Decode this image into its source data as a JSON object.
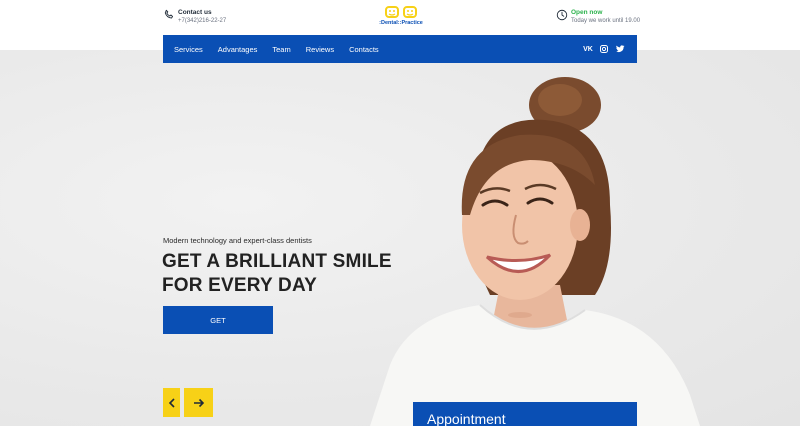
{
  "header": {
    "contact_title": "Contact us",
    "contact_phone": "+7(342)216-22-27",
    "logo_text": ":Dental::Practice",
    "hours_title": "Open now",
    "hours_sub": "Today we work until 19.00"
  },
  "nav": {
    "items": [
      "Services",
      "Advantages",
      "Team",
      "Reviews",
      "Contacts"
    ],
    "socials": [
      "vk-icon",
      "instagram-icon",
      "twitter-icon"
    ],
    "vk_label": "VK"
  },
  "hero": {
    "tagline": "Modern technology and expert-class dentists",
    "headline_line1": "GET A BRILLIANT SMILE",
    "headline_line2": "FOR EVERY DAY",
    "cta_label": "GET"
  },
  "appointment": {
    "title": "Appointment"
  },
  "colors": {
    "brand_blue": "#0a4fb4",
    "accent_yellow": "#f7d117",
    "open_green": "#2bb24c"
  }
}
